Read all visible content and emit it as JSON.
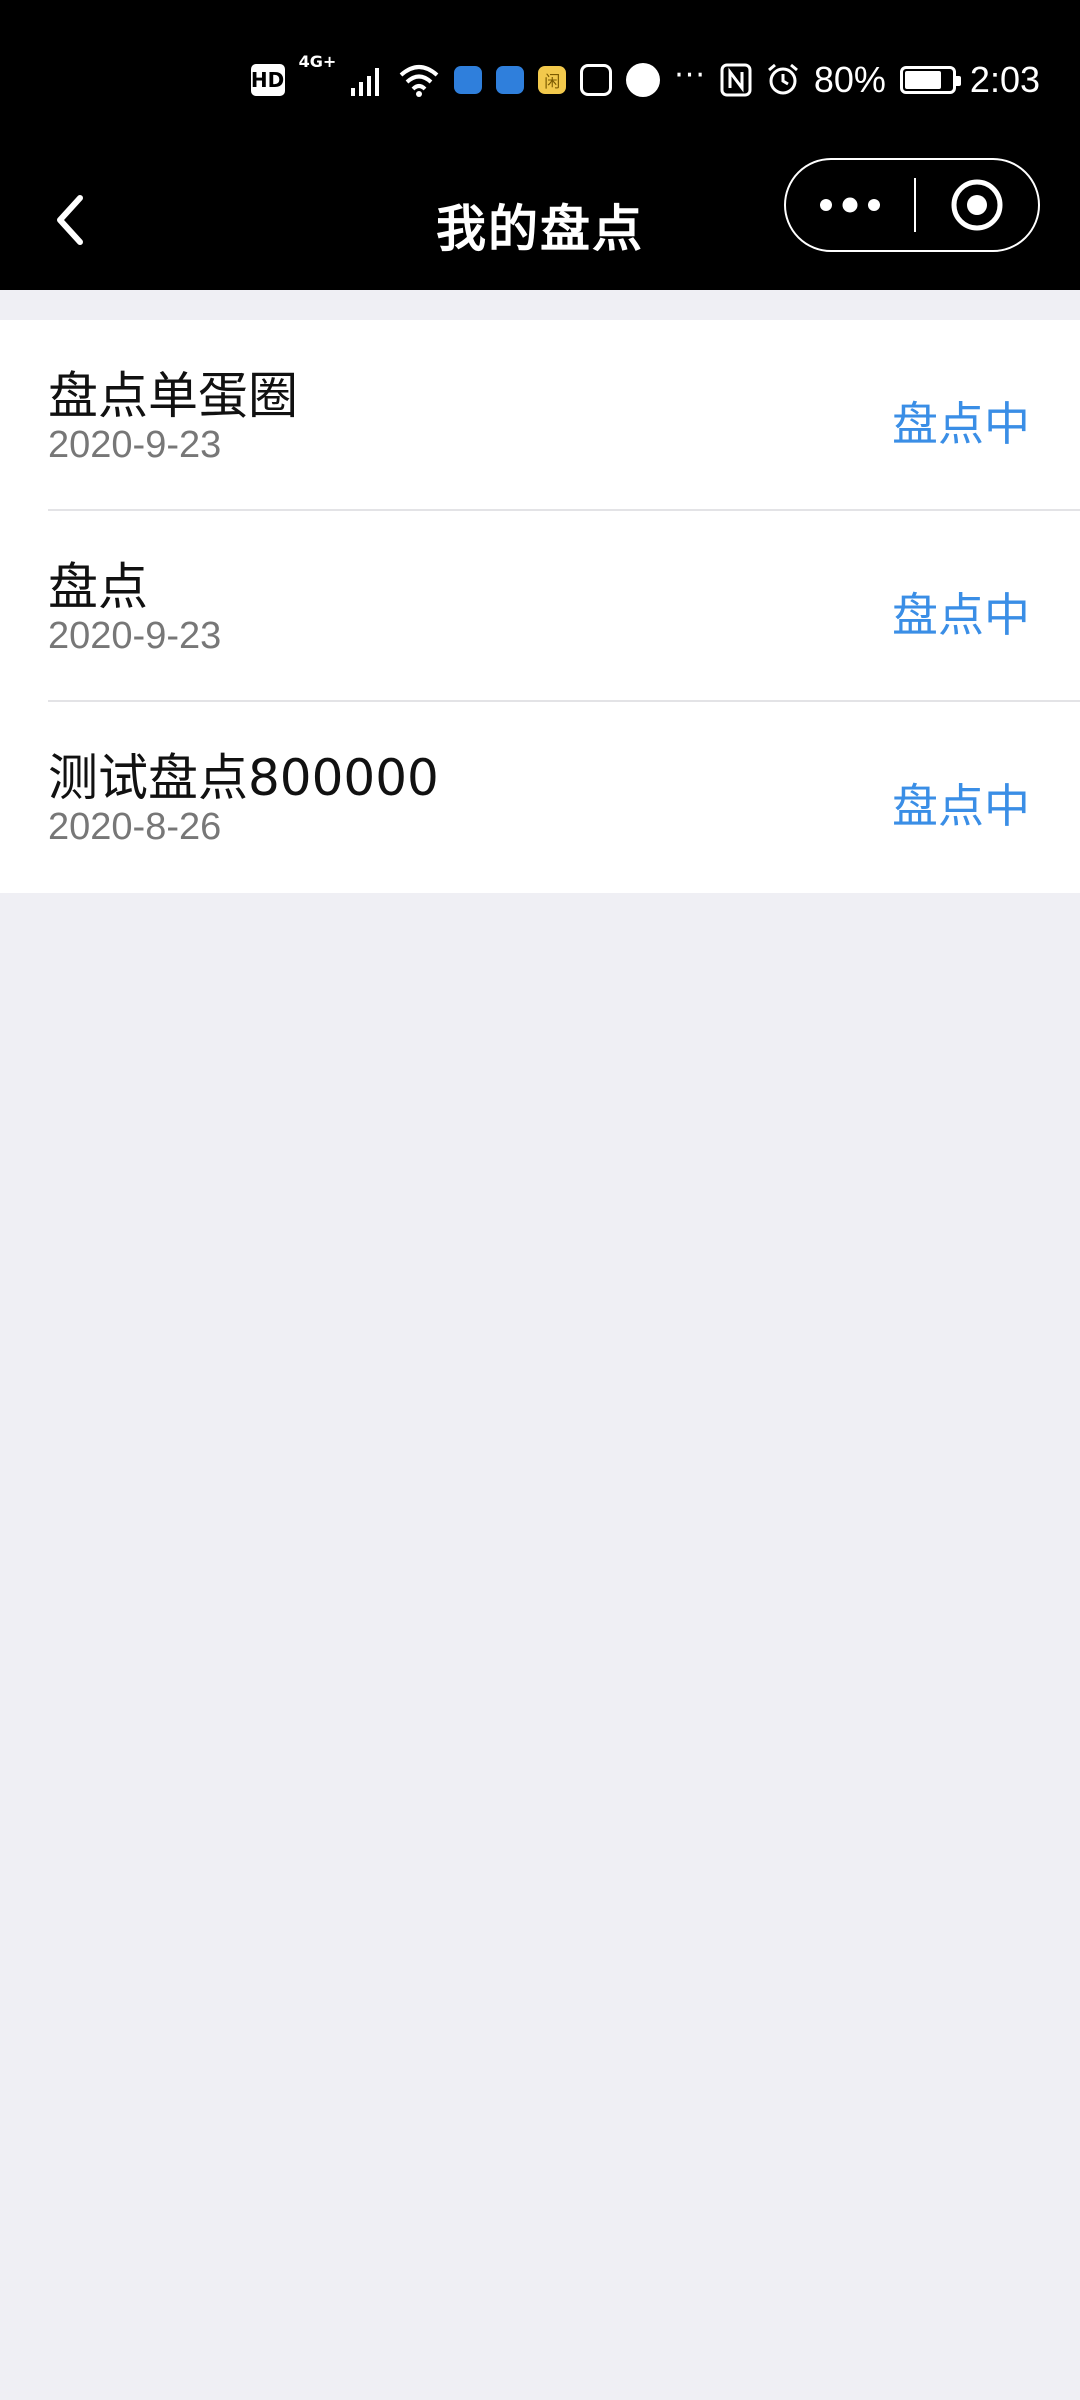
{
  "status_bar": {
    "hd": "HD",
    "network": "4G+",
    "app_badge": "闲",
    "more": "···",
    "battery_percent": "80%",
    "battery_level": 0.8,
    "time": "2:03"
  },
  "nav": {
    "title": "我的盘点"
  },
  "list": {
    "items": [
      {
        "name": "盘点单蛋圈",
        "date": "2020-9-23",
        "status": "盘点中"
      },
      {
        "name": "盘点",
        "date": "2020-9-23",
        "status": "盘点中"
      },
      {
        "name": "测试盘点800000",
        "date": "2020-8-26",
        "status": "盘点中"
      }
    ]
  },
  "colors": {
    "status_accent": "#3a8ee6",
    "top_bar": "#000000",
    "page_background": "#efeff4"
  }
}
